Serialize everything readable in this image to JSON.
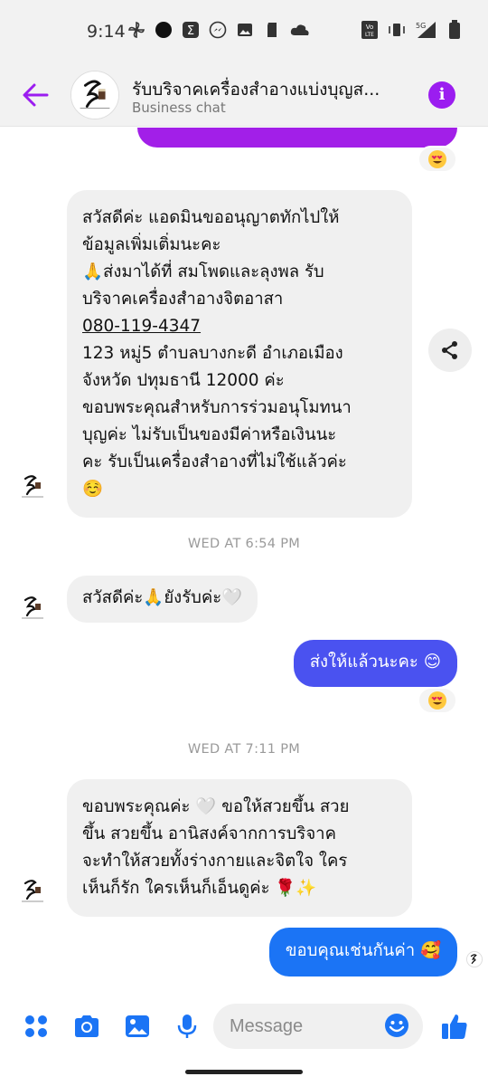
{
  "status_bar": {
    "time": "9:14",
    "left_icons": [
      "pinwheel-icon",
      "dark-circle-icon",
      "sigma-icon",
      "messenger-icon",
      "image-icon",
      "sd-card-icon",
      "cloud-icon"
    ],
    "right_icons": [
      "volte-icon",
      "vibrate-icon",
      "signal-5g-icon",
      "battery-icon"
    ],
    "network_label": "5G",
    "volte_label": "Vo LTE"
  },
  "header": {
    "title": "รับบริจาคเครื่องสำอางแบ่งบุญส...",
    "subtitle": "Business chat",
    "accent_color": "#9b1df0"
  },
  "messages": [
    {
      "id": "m1",
      "direction": "incoming",
      "lines": [
        "สวัสดีค่ะ แอดมินขออนุญาตทักไปให้",
        "ข้อมูลเพิ่มเติ่มนะคะ",
        "🙏ส่งมาได้ที่ สมโพดและลุงพล รับ",
        "บริจาคเครื่องสำอางจิตอาสา",
        "080-119-4347",
        "123 หมู่5 ตำบลบางกะดี อำเภอเมือง",
        "จังหวัด ปทุมธานี 12000 ค่ะ",
        "ขอบพระคุณสำหรับการร่วมอนุโมทนา",
        "บุญค่ะ ไม่รับเป็นของมีค่าหรือเงินนะ",
        "คะ รับเป็นเครื่องสำอางที่ไม่ใช้แล้วค่ะ",
        "☺️"
      ]
    },
    {
      "id": "ts1",
      "type": "timestamp",
      "text": "WED AT 6:54 PM"
    },
    {
      "id": "m2",
      "direction": "incoming",
      "text": "สวัสดีค่ะ🙏ยังรับค่ะ🤍"
    },
    {
      "id": "m3",
      "direction": "outgoing",
      "text": "ส่งให้แล้วนะคะ 😊",
      "color": "#4a52f0"
    },
    {
      "id": "ts2",
      "type": "timestamp",
      "text": "WED AT 7:11 PM"
    },
    {
      "id": "m4",
      "direction": "incoming",
      "lines": [
        "ขอบพระคุณค่ะ 🤍 ขอให้สวยขึ้น สวย",
        "ขึ้น สวยขึ้น อานิสงค์จากการบริจาค",
        "จะทำให้สวยทั้งร่างกายและจิตใจ ใคร",
        "เห็นก็รัก ใครเห็นก็เอ็นดูค่ะ 🌹✨"
      ]
    },
    {
      "id": "m5",
      "direction": "outgoing",
      "text": "ขอบคุณเช่นกันค่า 🥰",
      "color": "#1b74f5"
    }
  ],
  "reactions": [
    "heart-eyes-emoji",
    "heart-eyes-emoji"
  ],
  "top_message_color": "#a21fe8",
  "composer": {
    "placeholder": "Message",
    "icons": [
      "apps-icon",
      "camera-icon",
      "gallery-icon",
      "microphone-icon",
      "emoji-icon",
      "thumbs-up-icon"
    ],
    "icon_color": "#1b74f5"
  }
}
